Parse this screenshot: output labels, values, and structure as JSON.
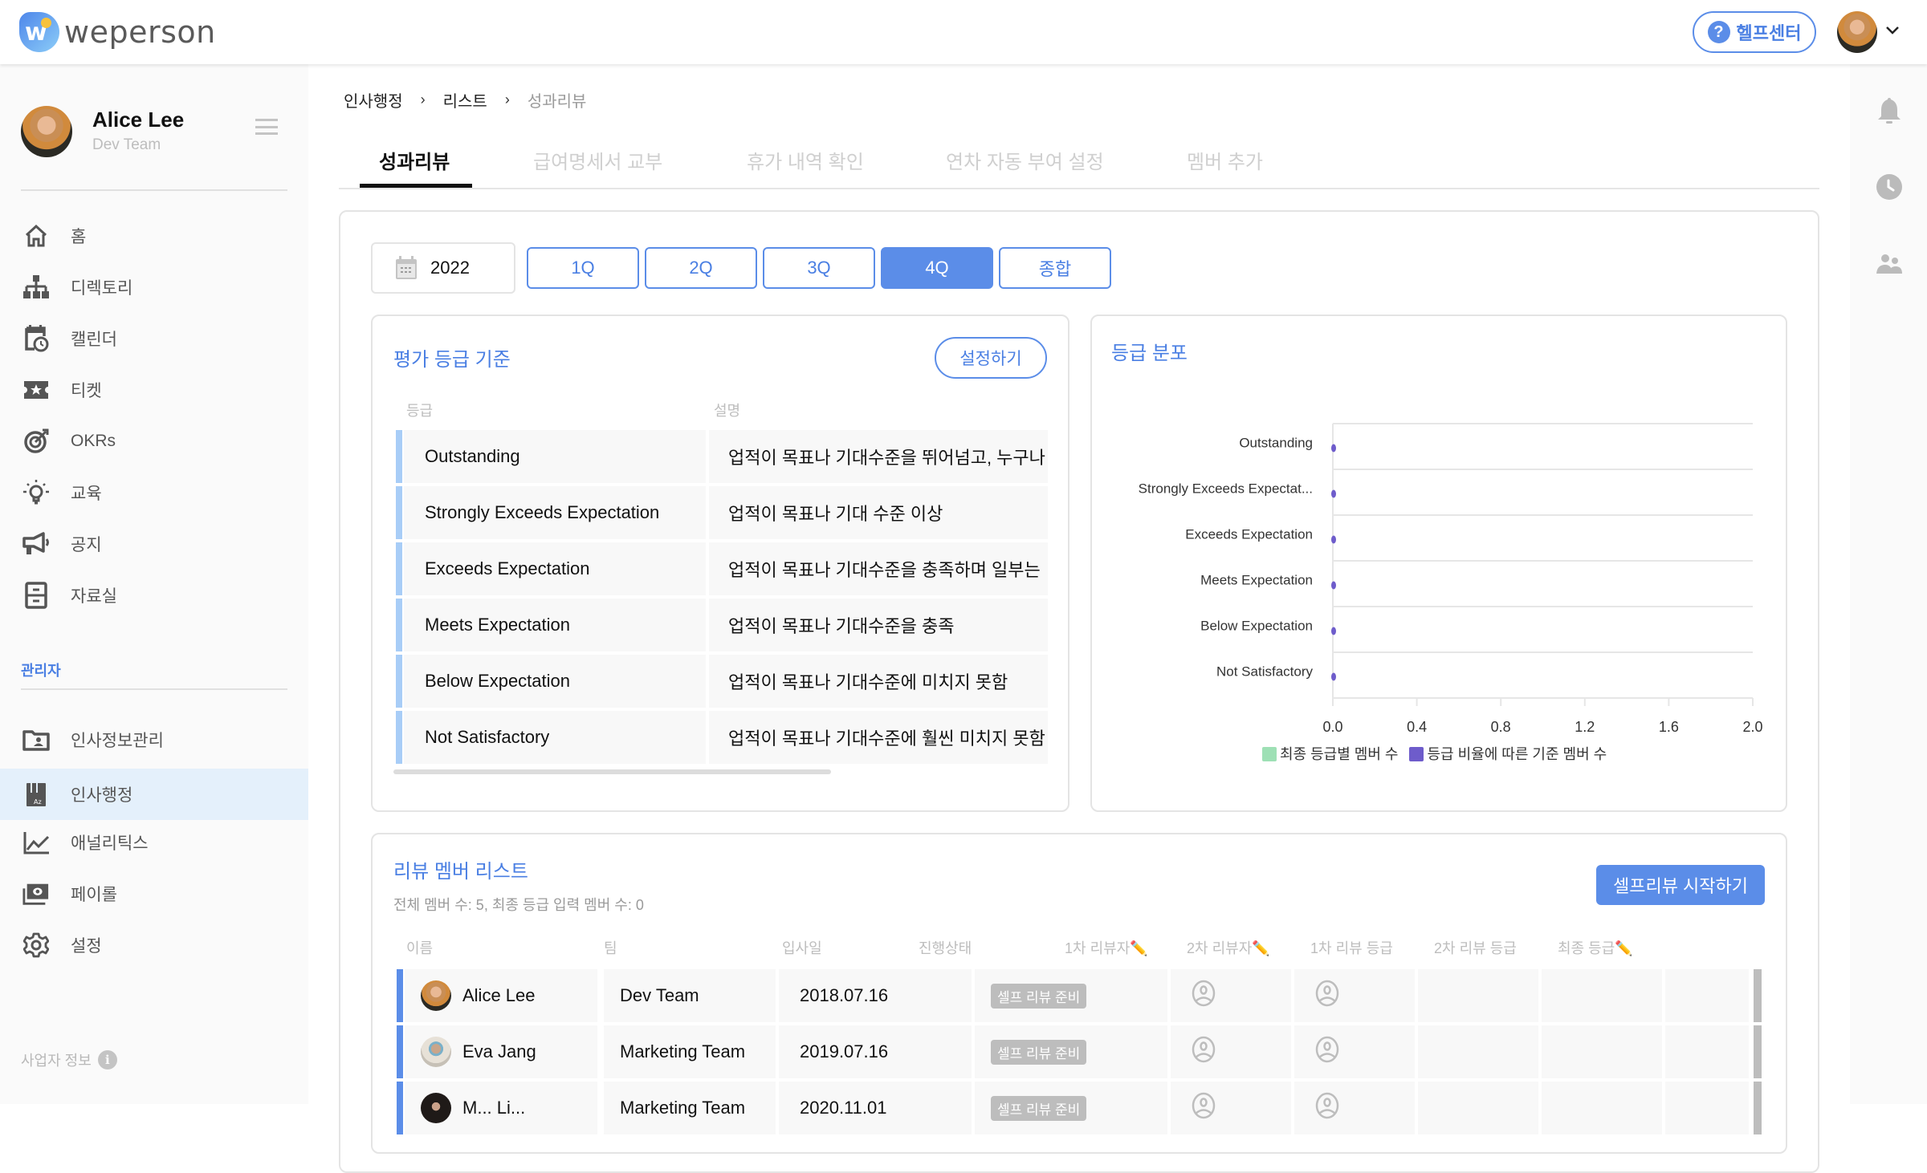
{
  "app": {
    "brand": "weperson",
    "help_label": "헬프센터",
    "accent_color": "#5b8de8"
  },
  "user": {
    "name": "Alice Lee",
    "team": "Dev Team"
  },
  "sidebar": {
    "items": [
      {
        "label": "홈",
        "icon": "home-icon"
      },
      {
        "label": "디렉토리",
        "icon": "org-chart-icon"
      },
      {
        "label": "캘린더",
        "icon": "calendar-clock-icon"
      },
      {
        "label": "티켓",
        "icon": "ticket-icon"
      },
      {
        "label": "OKRs",
        "icon": "target-icon"
      },
      {
        "label": "교육",
        "icon": "lightbulb-icon"
      },
      {
        "label": "공지",
        "icon": "megaphone-icon"
      },
      {
        "label": "자료실",
        "icon": "file-cabinet-icon"
      }
    ],
    "admin_section_label": "관리자",
    "admin_items": [
      {
        "label": "인사정보관리",
        "icon": "folder-person-icon",
        "active": false
      },
      {
        "label": "인사행정",
        "icon": "sort-az-icon",
        "active": true
      },
      {
        "label": "애널리틱스",
        "icon": "line-chart-icon",
        "active": false
      },
      {
        "label": "페이롤",
        "icon": "money-icon",
        "active": false
      },
      {
        "label": "설정",
        "icon": "gear-icon",
        "active": false
      }
    ],
    "business_info_label": "사업자 정보"
  },
  "breadcrumb": [
    "인사행정",
    "리스트",
    "성과리뷰"
  ],
  "breadcrumb_separator": "›",
  "tabs": [
    {
      "label": "성과리뷰",
      "active": true
    },
    {
      "label": "급여명세서 교부",
      "active": false
    },
    {
      "label": "휴가 내역 확인",
      "active": false
    },
    {
      "label": "연차 자동 부여 설정",
      "active": false
    },
    {
      "label": "멤버 추가",
      "active": false
    }
  ],
  "filters": {
    "year": "2022",
    "quarters": [
      {
        "label": "1Q",
        "active": false
      },
      {
        "label": "2Q",
        "active": false
      },
      {
        "label": "3Q",
        "active": false
      },
      {
        "label": "4Q",
        "active": true
      },
      {
        "label": "종합",
        "active": false
      }
    ]
  },
  "criteria": {
    "title": "평가 등급 기준",
    "settings_label": "설정하기",
    "columns": [
      "등급",
      "설명"
    ],
    "rows": [
      {
        "grade": "Outstanding",
        "desc": "업적이 목표나 기대수준을 뛰어넘고, 누구나"
      },
      {
        "grade": "Strongly Exceeds Expectation",
        "desc": "업적이 목표나 기대 수준 이상"
      },
      {
        "grade": "Exceeds Expectation",
        "desc": "업적이 목표나 기대수준을 충족하며 일부는"
      },
      {
        "grade": "Meets Expectation",
        "desc": "업적이 목표나 기대수준을 충족"
      },
      {
        "grade": "Below Expectation",
        "desc": "업적이 목표나 기대수준에 미치지 못함"
      },
      {
        "grade": "Not Satisfactory",
        "desc": "업적이 목표나 기대수준에 훨씬 미치지 못함"
      }
    ]
  },
  "distribution": {
    "title": "등급 분포"
  },
  "chart_data": {
    "type": "bar",
    "orientation": "horizontal",
    "title": "등급 분포",
    "categories": [
      "Outstanding",
      "Strongly Exceeds Expectat...",
      "Exceeds Expectation",
      "Meets Expectation",
      "Below Expectation",
      "Not Satisfactory"
    ],
    "series": [
      {
        "name": "최종 등급별 멤버 수",
        "color": "#9ee0b5",
        "values": [
          0,
          0,
          0,
          0,
          0,
          0
        ]
      },
      {
        "name": "등급 비율에 따른 기준 멤버 수",
        "color": "#6e5ccb",
        "values": [
          0,
          0,
          0,
          0,
          0,
          0
        ]
      }
    ],
    "xlim": [
      0,
      2.0
    ],
    "xticks": [
      "0.0",
      "0.4",
      "0.8",
      "1.2",
      "1.6",
      "2.0"
    ],
    "xlabel": "",
    "ylabel": "",
    "grid": true,
    "legend_position": "bottom"
  },
  "members": {
    "title": "리뷰 멤버 리스트",
    "summary": "전체 멤버 수: 5, 최종 등급 입력 멤버 수: 0",
    "start_button": "셀프리뷰 시작하기",
    "columns": [
      "이름",
      "팀",
      "입사일",
      "진행상태",
      "1차 리뷰자✏️",
      "2차 리뷰자✏️",
      "1차 리뷰 등급",
      "2차 리뷰 등급",
      "최종 등급✏️"
    ],
    "rows": [
      {
        "name": "Alice Lee",
        "team": "Dev Team",
        "joined": "2018.07.16",
        "status": "셀프 리뷰 준비",
        "avatar": "alice"
      },
      {
        "name": "Eva Jang",
        "team": "Marketing Team",
        "joined": "2019.07.16",
        "status": "셀프 리뷰 준비",
        "avatar": "eva"
      },
      {
        "name": "M... Li...",
        "team": "Marketing Team",
        "joined": "2020.11.01",
        "status": "셀프 리뷰 준비",
        "avatar": "m"
      }
    ]
  }
}
